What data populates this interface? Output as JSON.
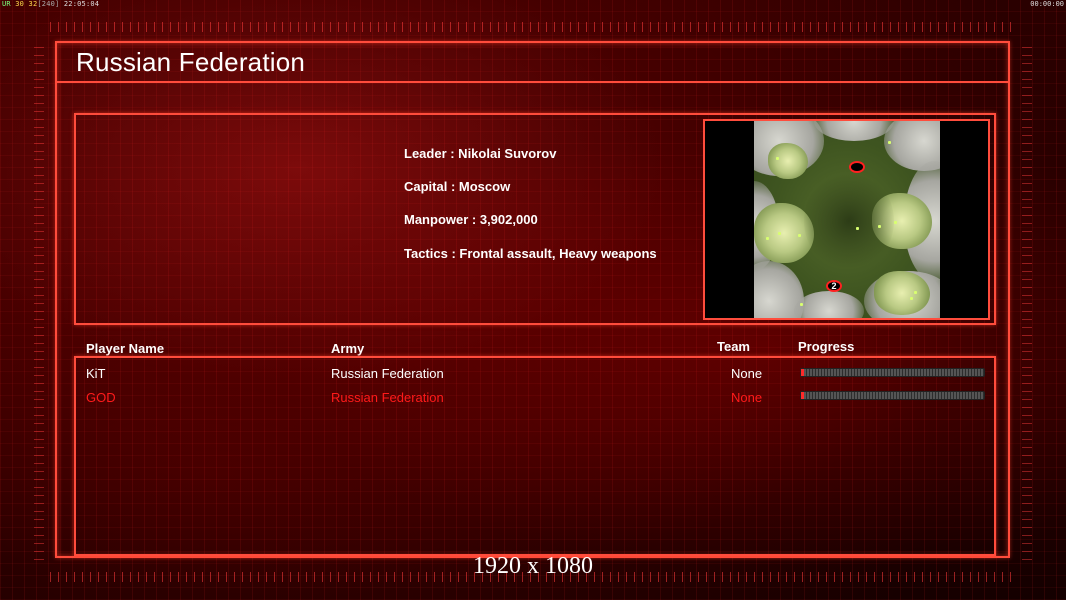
{
  "hud": {
    "label": "UR",
    "fps": "30",
    "fps_target": "32",
    "frame_bracket": "[240]",
    "clock": "22:05:04",
    "timer": "00:00:00"
  },
  "title": "Russian Federation",
  "info": {
    "leader": "Leader : Nikolai Suvorov",
    "capital": "Capital : Moscow",
    "manpower": "Manpower : 3,902,000",
    "tactics": "Tactics : Frontal assault, Heavy weapons"
  },
  "minimap": {
    "marker_2": "2"
  },
  "table": {
    "headers": {
      "player": "Player Name",
      "army": "Army",
      "team": "Team",
      "progress": "Progress"
    },
    "rows": [
      {
        "player": "KiT",
        "army": "Russian Federation",
        "team": "None",
        "progress": 0.01,
        "color": "#ffffff"
      },
      {
        "player": "GOD",
        "army": "Russian Federation",
        "team": "None",
        "progress": 0.01,
        "color": "#ff1a1a"
      }
    ]
  },
  "resolution": "1920 x 1080",
  "colors": {
    "accent": "#ff4c3c",
    "highlight_player": "#ff1a1a"
  }
}
